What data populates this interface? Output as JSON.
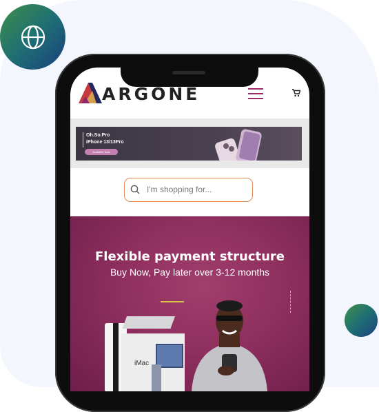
{
  "brand": {
    "name": "ARGONE"
  },
  "icons": {
    "globe": "globe-icon",
    "menu": "hamburger-menu-icon",
    "cart": "cart-icon",
    "search": "search-icon"
  },
  "colors": {
    "brand_accent": "#9c2a63",
    "search_border": "#e48b54",
    "hero_bg": "#8e2f5e",
    "badge_green": "#3f8f4a",
    "badge_blue": "#1b3f7d"
  },
  "banner": {
    "line1": "Oh.So.Pro",
    "line2": "iPhone 13/13Pro",
    "button": "Available Now"
  },
  "search": {
    "placeholder": "I'm shopping for..."
  },
  "hero": {
    "title": "Flexible payment structure",
    "subtitle": "Buy Now, Pay later over 3-12 months",
    "product_label": "iMac"
  }
}
